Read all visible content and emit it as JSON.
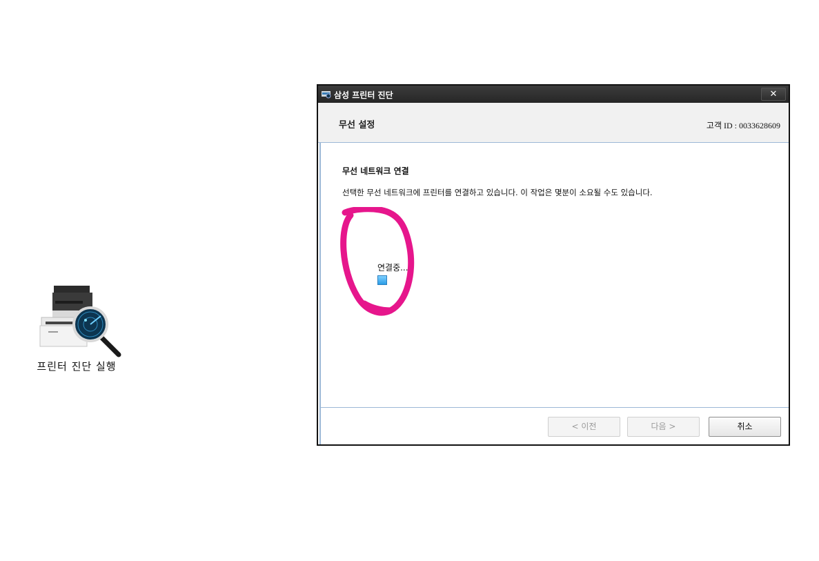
{
  "desktop": {
    "shortcut_label": "프린터 진단 실행"
  },
  "window": {
    "title": "삼성 프린터 진단",
    "close_label": "✕",
    "header": {
      "title": "무선 설정",
      "customer_id_label": "고객",
      "customer_id_value": "ID : 0033628609"
    },
    "content": {
      "section_title": "무선 네트워크 연결",
      "description": "선택한 무선 네트워크에 프린터를 연결하고 있습니다. 이 작업은 몇분이 소요될 수도 있습니다.",
      "status": "연결중..."
    },
    "buttons": {
      "previous": "< 이전",
      "next": "다음 >",
      "cancel": "취소"
    }
  },
  "colors": {
    "annotation": "#e6168c",
    "titlebar": "#2e2e2e",
    "header_bg": "#f1f1f1",
    "divider": "#9cb8d6"
  }
}
